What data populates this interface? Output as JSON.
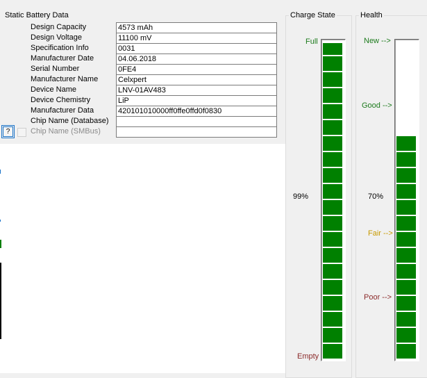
{
  "static": {
    "title": "Static Battery Data",
    "rows": [
      {
        "label": "Design Capacity",
        "value": "4573 mAh"
      },
      {
        "label": "Design Voltage",
        "value": "11100 mV"
      },
      {
        "label": "Specification Info",
        "value": "0031"
      },
      {
        "label": "Manufacturer Date",
        "value": "04.06.2018"
      },
      {
        "label": "Serial Number",
        "value": "0FE4"
      },
      {
        "label": "Manufacturer Name",
        "value": "Celxpert"
      },
      {
        "label": "Device Name",
        "value": "LNV-01AV483"
      },
      {
        "label": "Device Chemistry",
        "value": "LiP"
      },
      {
        "label": "Manufacturer Data",
        "value": "420101010000ff0ffe0ffd0f0830"
      },
      {
        "label": "Chip Name (Database)",
        "value": ""
      },
      {
        "label": "Chip Name (SMBus)",
        "value": ""
      }
    ],
    "help_label": "?"
  },
  "charge": {
    "title": "Charge State",
    "full_label": "Full",
    "empty_label": "Empty",
    "percent_text": "99%",
    "level": 0.99,
    "bar_color": "#008000",
    "full_color": "#1b7a1b",
    "empty_color": "#8b2a2a"
  },
  "health": {
    "title": "Health",
    "new_label": "New -->",
    "good_label": "Good -->",
    "fair_label": "Fair -->",
    "poor_label": "Poor -->",
    "percent_text": "70%",
    "level": 0.7,
    "new_color": "#1b7a1b",
    "good_color": "#1b7a1b",
    "fair_color": "#c79a00",
    "poor_color": "#8b2a2a"
  }
}
